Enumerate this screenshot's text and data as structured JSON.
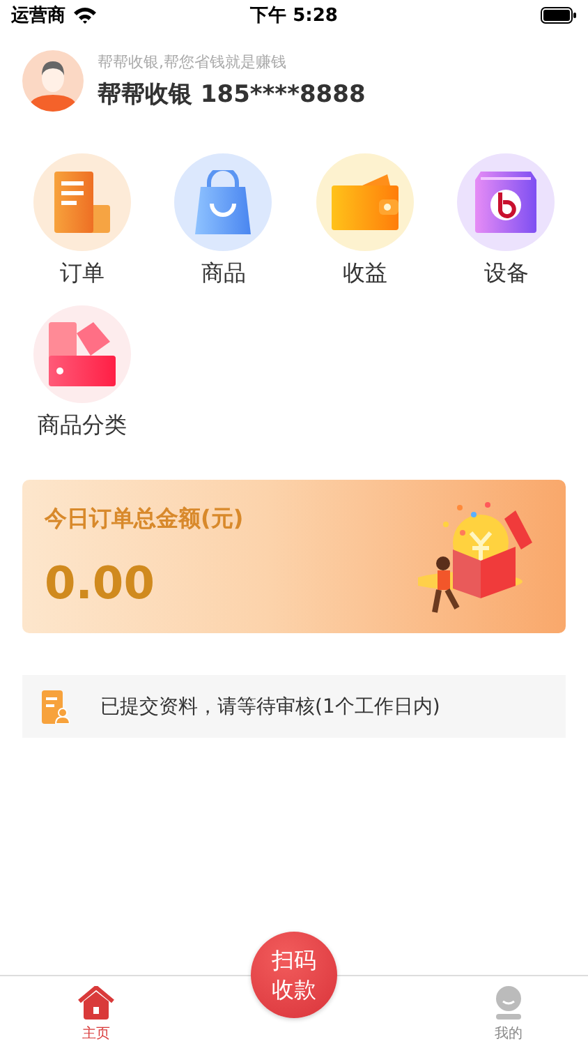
{
  "status_bar": {
    "carrier": "运营商",
    "time": "下午 5:28"
  },
  "profile": {
    "slogan": "帮帮收银,帮您省钱就是赚钱",
    "name": "帮帮收银 185****8888"
  },
  "menu": [
    {
      "label": "订单"
    },
    {
      "label": "商品"
    },
    {
      "label": "收益"
    },
    {
      "label": "设备"
    },
    {
      "label": "商品分类"
    }
  ],
  "summary": {
    "title": "今日订单总金额(元)",
    "amount": "0.00"
  },
  "notice": {
    "text": "已提交资料，请等待审核(1个工作日内)"
  },
  "scan_button": {
    "label": "扫码收款"
  },
  "tabs": [
    {
      "label": "主页",
      "selected": true
    },
    {
      "label": "我的",
      "selected": false
    }
  ]
}
